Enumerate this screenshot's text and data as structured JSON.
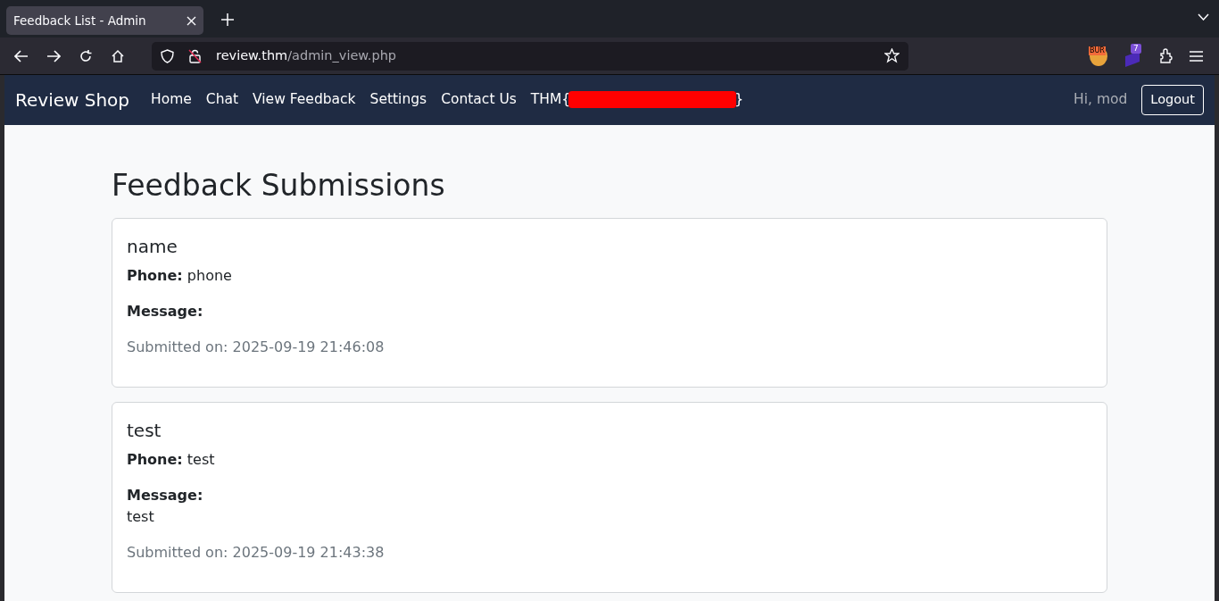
{
  "browser": {
    "tab_title": "Feedback List - Admin",
    "url_host": "review.thm",
    "url_path": "/admin_view.php",
    "extension_badges": [
      "BUR",
      "7"
    ]
  },
  "navbar": {
    "brand": "Review Shop",
    "links": [
      {
        "text": "Home"
      },
      {
        "text": "Chat"
      },
      {
        "text": "View Feedback"
      },
      {
        "text": "Settings"
      },
      {
        "text": "Contact Us"
      }
    ],
    "flag": {
      "text_start": "THM{",
      "redacted": true,
      "text_end": "}"
    },
    "greeting": "Hi, mod",
    "logout": "Logout"
  },
  "page": {
    "title": "Feedback Submissions"
  },
  "feedback": [
    {
      "name": "name",
      "phone": "**Phone:** phone",
      "message_label": "Message:",
      "submitted": "Submitted on: 2025-09-19 21:46:08"
    },
    {
      "name": "test",
      "phone": "**Phone:** test",
      "message_label": "Message:",
      "message": "test",
      "submitted": "Submitted on: 2025-09-19 21:43:38"
    }
  ]
}
